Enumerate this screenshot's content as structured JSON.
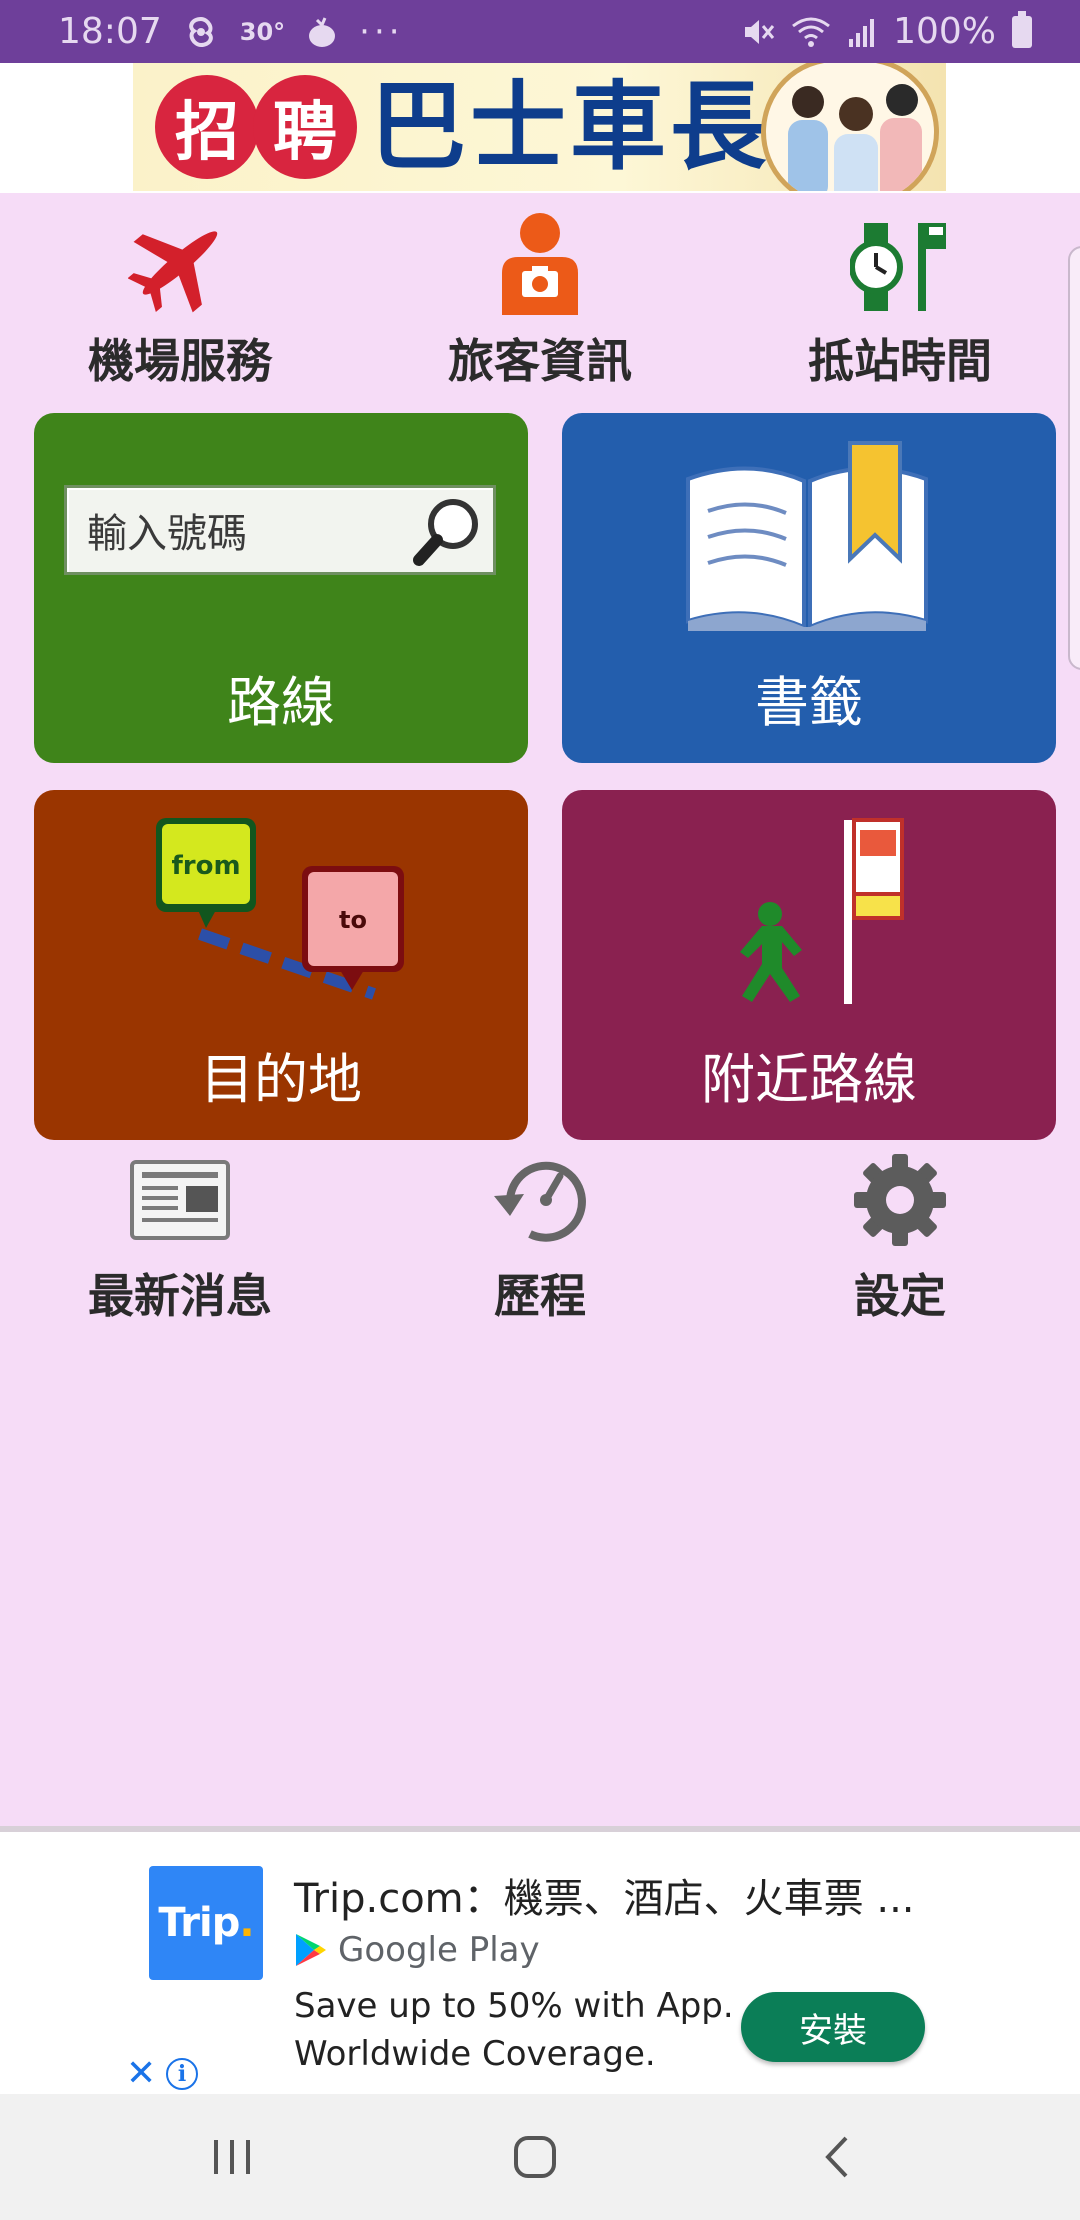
{
  "status_bar": {
    "time": "18:07",
    "temperature": "30°",
    "more": "···",
    "battery": "100%",
    "icons": [
      "weather-swirl-icon",
      "fruit-icon",
      "mute-icon",
      "wifi-icon",
      "signal-icon",
      "battery-icon"
    ]
  },
  "banner": {
    "char1": "招",
    "char2": "聘",
    "main": "巴士車長"
  },
  "top_shortcuts": [
    {
      "label": "機場服務",
      "icon": "airplane-icon"
    },
    {
      "label": "旅客資訊",
      "icon": "traveler-camera-icon"
    },
    {
      "label": "抵站時間",
      "icon": "watch-bus-stop-icon"
    }
  ],
  "tiles": {
    "route": {
      "label": "路線",
      "search_placeholder": "輸入號碼"
    },
    "bookmark": {
      "label": "書籤"
    },
    "destination": {
      "label": "目的地",
      "from_text": "from",
      "to_text": "to"
    },
    "nearby": {
      "label": "附近路線"
    }
  },
  "bottom_shortcuts": [
    {
      "label": "最新消息",
      "icon": "newspaper-icon"
    },
    {
      "label": "歷程",
      "icon": "history-clock-icon"
    },
    {
      "label": "設定",
      "icon": "gear-icon"
    }
  ],
  "ad": {
    "logo_text": "Trip",
    "logo_dot": ".",
    "title": "Trip.com：機票、酒店、火車票 ...",
    "store": "Google Play",
    "line1": "Save up to 50% with App.",
    "line2": "Worldwide Coverage.",
    "install": "安裝",
    "close": "✕",
    "info": "i"
  },
  "colors": {
    "status_bar": "#6e3f9a",
    "background": "#f6dcf7",
    "route_tile": "#3f841a",
    "bookmark_tile": "#235ead",
    "destination_tile": "#9a3500",
    "nearby_tile": "#8a2150",
    "install_button": "#0b7e57"
  }
}
